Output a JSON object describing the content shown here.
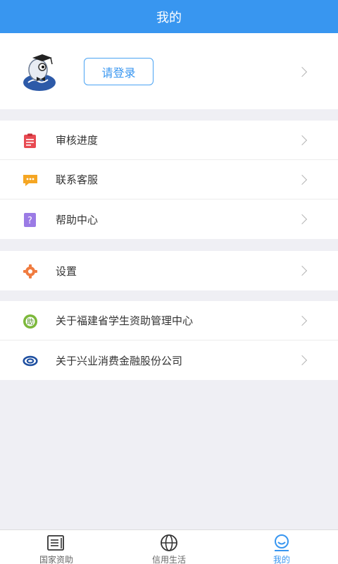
{
  "header": {
    "title": "我的"
  },
  "profile": {
    "login_label": "请登录",
    "avatar_icon": "graduate-mascot-icon"
  },
  "groups": [
    {
      "items": [
        {
          "label": "审核进度",
          "icon": "clipboard-icon"
        },
        {
          "label": "联系客服",
          "icon": "chat-icon"
        },
        {
          "label": "帮助中心",
          "icon": "help-icon"
        }
      ]
    },
    {
      "items": [
        {
          "label": "设置",
          "icon": "gear-icon"
        }
      ]
    },
    {
      "items": [
        {
          "label": "关于福建省学生资助管理中心",
          "icon": "fujian-aid-logo-icon"
        },
        {
          "label": "关于兴业消费金融股份公司",
          "icon": "cib-logo-icon"
        }
      ]
    }
  ],
  "tabbar": {
    "tabs": [
      {
        "label": "国家资助",
        "icon": "newspaper-icon",
        "active": false
      },
      {
        "label": "信用生活",
        "icon": "globe-icon",
        "active": false
      },
      {
        "label": "我的",
        "icon": "profile-icon",
        "active": true
      }
    ]
  },
  "colors": {
    "primary": "#3896f0",
    "background": "#efeff4",
    "clipboard": "#e84a52",
    "chat": "#f5a623",
    "help": "#9b7be5",
    "gear": "#f07c40"
  }
}
